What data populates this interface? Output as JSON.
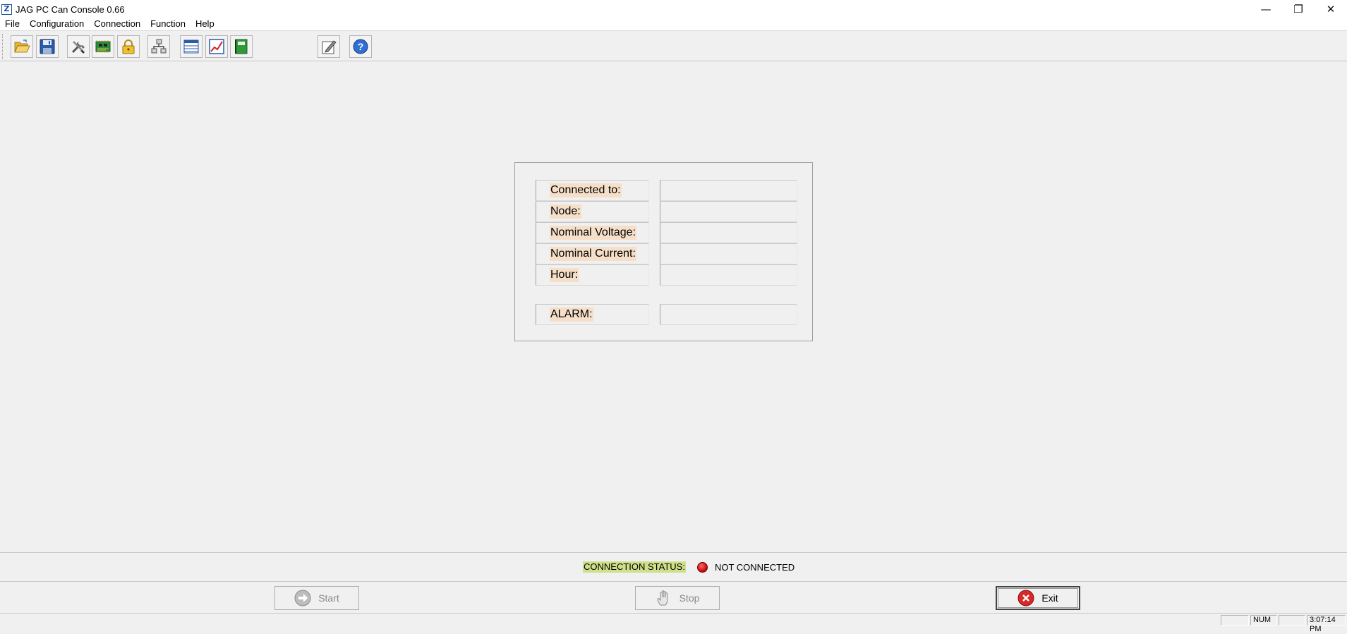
{
  "window": {
    "title": "JAG PC Can Console 0.66",
    "app_icon_glyph": "Z",
    "minimize_glyph": "—",
    "restore_glyph": "❐",
    "close_glyph": "✕"
  },
  "menu": {
    "items": [
      "File",
      "Configuration",
      "Connection",
      "Function",
      "Help"
    ]
  },
  "toolbar": {
    "buttons": [
      {
        "icon": "open-folder-icon"
      },
      {
        "icon": "save-icon"
      },
      {
        "icon": "tools-icon"
      },
      {
        "icon": "circuit-board-icon"
      },
      {
        "icon": "lock-icon"
      },
      {
        "icon": "network-icon"
      },
      {
        "icon": "data-table-icon"
      },
      {
        "icon": "chart-icon"
      },
      {
        "icon": "green-book-icon"
      },
      {
        "icon": "edit-pencil-icon"
      },
      {
        "icon": "help-icon"
      }
    ]
  },
  "info_panel": {
    "rows": [
      {
        "label": "Connected to:",
        "value": ""
      },
      {
        "label": "Node:",
        "value": ""
      },
      {
        "label": "Nominal Voltage:",
        "value": ""
      },
      {
        "label": "Nominal Current:",
        "value": ""
      },
      {
        "label": "Hour:",
        "value": ""
      }
    ],
    "alarm": {
      "label": "ALARM:",
      "value": ""
    }
  },
  "connection": {
    "label": "CONNECTION STATUS:",
    "value": "NOT CONNECTED",
    "led_color": "#d41414"
  },
  "buttons": {
    "start_label": "Start",
    "stop_label": "Stop",
    "exit_label": "Exit"
  },
  "statusbar": {
    "num": "NUM",
    "time": "3:07:14 PM"
  }
}
